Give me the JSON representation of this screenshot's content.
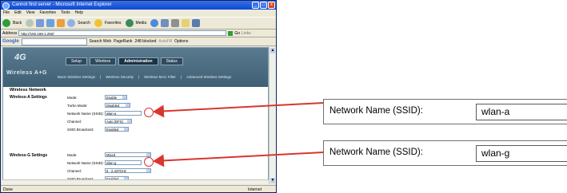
{
  "browser": {
    "title": "Cannot find server - Microsoft Internet Explorer",
    "menu": [
      "File",
      "Edit",
      "View",
      "Favorites",
      "Tools",
      "Help"
    ],
    "toolbar": {
      "back": "Back",
      "search": "Search",
      "favorites": "Favorites",
      "media": "Media"
    },
    "address_label": "Address",
    "address_value": "http://192.168.1.250/",
    "go_label": "Go",
    "links_label": "Links",
    "google_label": "Google",
    "search_web": "Search Web",
    "pagerank": "PageRank",
    "blocked": "248 blocked",
    "autofill": "AutoFill",
    "options": "Options",
    "status_left": "Done",
    "status_right": "Internet"
  },
  "router": {
    "logo": "4G",
    "logo_sub": "Wireless A+G",
    "tabs": [
      "Setup",
      "Wireless",
      "Administration",
      "Status"
    ],
    "active_tab": "Wireless",
    "subtabs": [
      "Basic Wireless Settings",
      "Wireless Security",
      "Wireless MAC Filter",
      "Advanced Wireless Settings"
    ],
    "section_title": "Wireless Network",
    "a_settings": {
      "label": "Wireless-A Settings",
      "rows": [
        {
          "label": "Mode:",
          "value": "Enable"
        },
        {
          "label": "Turbo Mode:",
          "value": "Disabled"
        },
        {
          "label": "Network Name (SSID):",
          "value": "wlan-a"
        },
        {
          "label": "Channel:",
          "value": "Auto (DFS)"
        },
        {
          "label": "SSID Broadcast:",
          "value": "Enabled"
        }
      ]
    },
    "g_settings": {
      "label": "Wireless-G Settings",
      "rows": [
        {
          "label": "Mode:",
          "value": "Mixed"
        },
        {
          "label": "Network Name (SSID):",
          "value": "wlan-g"
        },
        {
          "label": "Channel:",
          "value": "6 - 2.437GHz"
        },
        {
          "label": "SSID Broadcast:",
          "value": "Enabled"
        }
      ]
    }
  },
  "callouts": [
    {
      "label": "Network Name (SSID):",
      "value": "wlan-a"
    },
    {
      "label": "Network Name (SSID):",
      "value": "wlan-g"
    }
  ],
  "colors": {
    "arrow": "#d9362e",
    "router_header": "#4a6a7f",
    "titlebar": "#0b4ad6"
  }
}
